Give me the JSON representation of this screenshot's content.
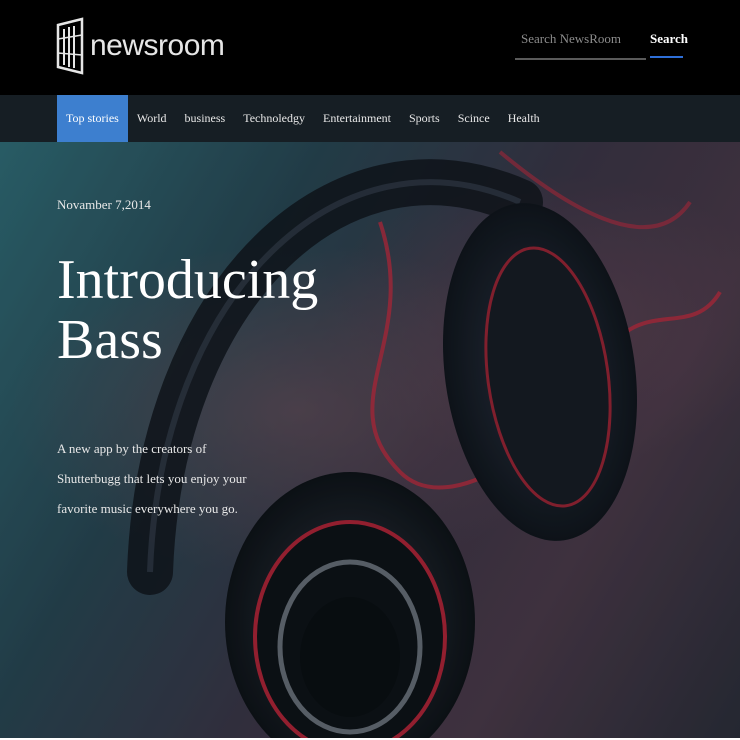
{
  "header": {
    "logo_text": "newsroom",
    "search_placeholder": "Search NewsRoom",
    "search_button": "Search"
  },
  "nav": {
    "items": [
      "Top stories",
      "World",
      "business",
      "Technoledgy",
      "Entertainment",
      "Sports",
      "Scince",
      "Health"
    ],
    "active_index": 0
  },
  "hero": {
    "date": "Novamber 7,2014",
    "title": "Introducing Bass",
    "description": "A new app by the creators of Shutterbugg that lets you enjoy your favorite music everywhere you go."
  },
  "colors": {
    "accent": "#3d7fcf",
    "nav_bg": "#161e24",
    "header_bg": "#000000"
  }
}
